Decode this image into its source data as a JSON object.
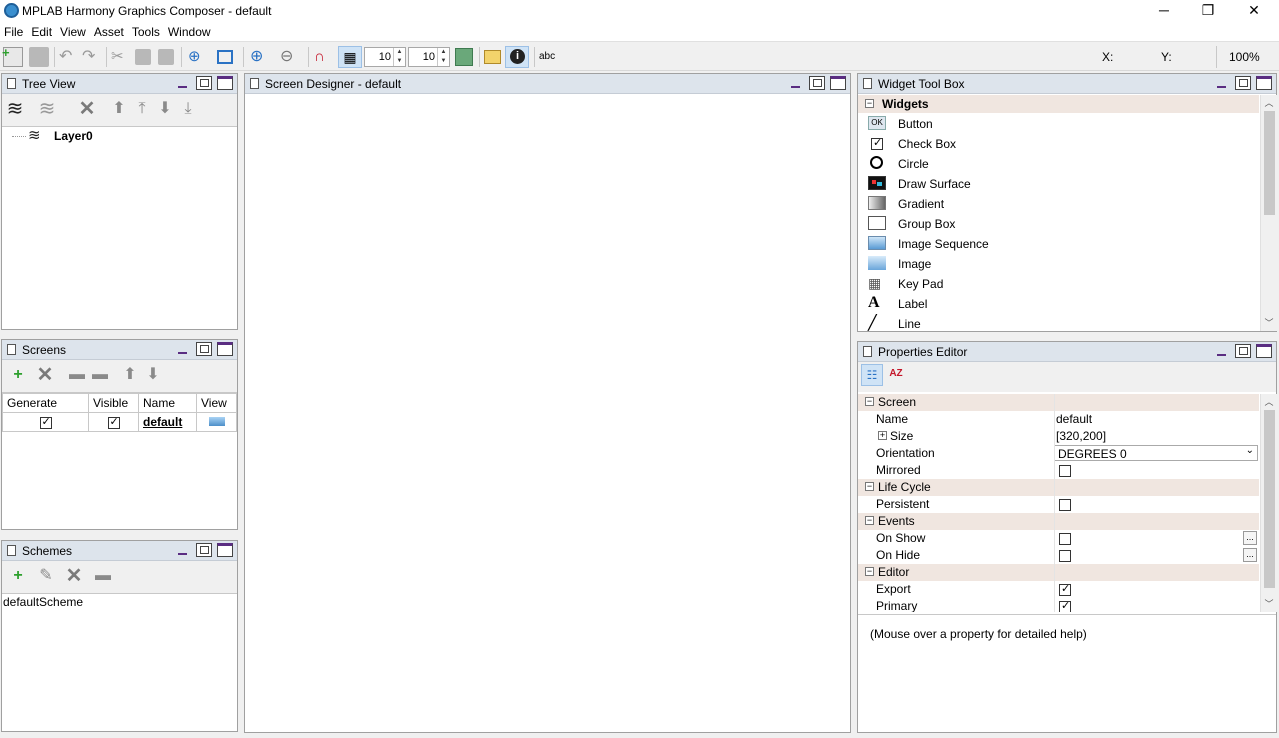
{
  "window": {
    "title": "MPLAB Harmony Graphics Composer - default",
    "controls": [
      "─",
      "❐",
      "✕"
    ]
  },
  "menu": [
    "File",
    "Edit",
    "View",
    "Asset",
    "Tools",
    "Window"
  ],
  "toolbar": {
    "grid_x": "10",
    "grid_y": "10",
    "text_tool": "abc",
    "x_label": "X:",
    "y_label": "Y:",
    "zoom": "100%"
  },
  "tree_view": {
    "title": "Tree View",
    "layer": "Layer0"
  },
  "screen_designer": {
    "title": "Screen Designer - default"
  },
  "screens": {
    "title": "Screens",
    "columns": [
      "Generate",
      "Visible",
      "Name",
      "View"
    ],
    "rows": [
      {
        "generate": true,
        "visible": true,
        "name": "default"
      }
    ]
  },
  "schemes": {
    "title": "Schemes",
    "items": [
      "defaultScheme"
    ]
  },
  "widget_toolbox": {
    "title": "Widget Tool Box",
    "group": "Widgets",
    "items": [
      {
        "label": "Button",
        "icon": "button-icon"
      },
      {
        "label": "Check Box",
        "icon": "checkbox-icon"
      },
      {
        "label": "Circle",
        "icon": "circle-icon"
      },
      {
        "label": "Draw Surface",
        "icon": "draw-surface-icon"
      },
      {
        "label": "Gradient",
        "icon": "gradient-icon"
      },
      {
        "label": "Group Box",
        "icon": "group-box-icon"
      },
      {
        "label": "Image Sequence",
        "icon": "image-sequence-icon"
      },
      {
        "label": "Image",
        "icon": "image-icon"
      },
      {
        "label": "Key Pad",
        "icon": "keypad-icon"
      },
      {
        "label": "Label",
        "icon": "label-icon"
      },
      {
        "label": "Line",
        "icon": "line-icon"
      }
    ],
    "button_icon_text": "OK"
  },
  "properties": {
    "title": "Properties Editor",
    "categories": {
      "screen": "Screen",
      "life_cycle": "Life Cycle",
      "events": "Events",
      "editor": "Editor"
    },
    "rows": {
      "name": {
        "label": "Name",
        "value": "default"
      },
      "size": {
        "label": "Size",
        "value": "[320,200]"
      },
      "orientation": {
        "label": "Orientation",
        "value": "DEGREES 0"
      },
      "mirrored": {
        "label": "Mirrored",
        "checked": false
      },
      "persistent": {
        "label": "Persistent",
        "checked": false
      },
      "on_show": {
        "label": "On Show",
        "checked": false
      },
      "on_hide": {
        "label": "On Hide",
        "checked": false
      },
      "export": {
        "label": "Export",
        "checked": true
      },
      "primary": {
        "label": "Primary",
        "checked": true
      }
    },
    "ellipsis": "...",
    "help": "(Mouse over a property for detailed help)"
  }
}
